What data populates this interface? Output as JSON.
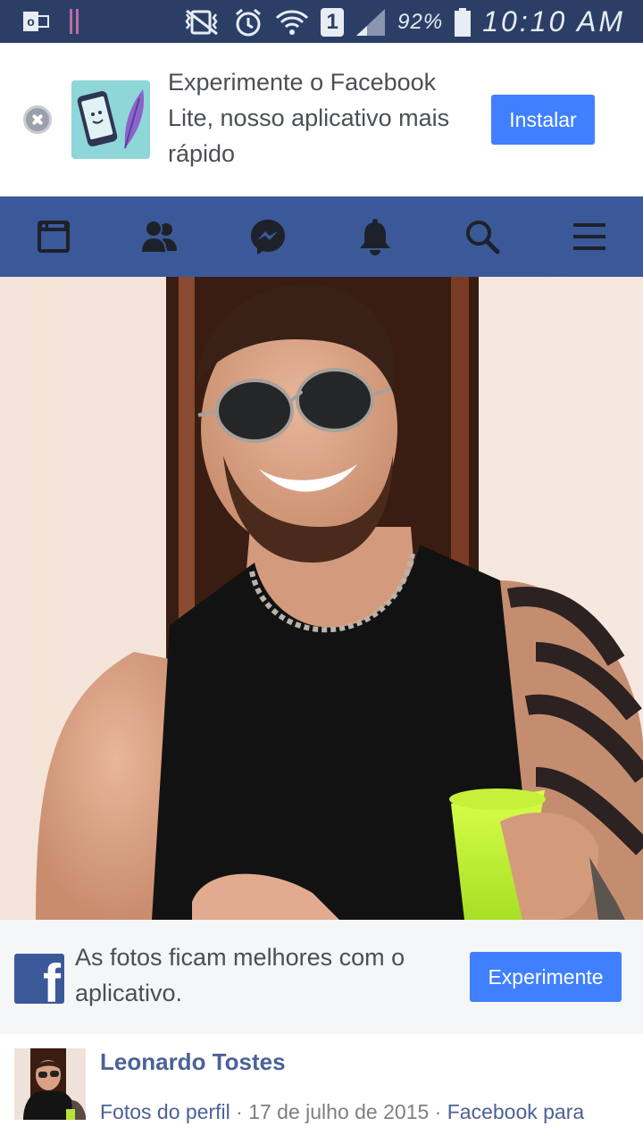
{
  "status_bar": {
    "battery": "92%",
    "clock": "10:10 AM",
    "sim": "1",
    "icons": [
      "outlook-icon",
      "pause-icon",
      "vibrate-icon",
      "alarm-icon",
      "wifi-icon",
      "sim-icon",
      "signal-icon",
      "battery-icon"
    ]
  },
  "install_banner": {
    "text": "Experimente o Facebook Lite, nosso aplicativo mais rápido",
    "button_label": "Instalar"
  },
  "nav": {
    "items": [
      "news-feed-icon",
      "friends-icon",
      "messenger-icon",
      "notifications-icon",
      "search-icon",
      "menu-icon"
    ]
  },
  "promo": {
    "text": "As fotos ficam melhores com o aplicativo.",
    "button_label": "Experimente",
    "logo_letter": "f"
  },
  "post": {
    "author": "Leonardo Tostes",
    "album": "Fotos do perfil",
    "separator": " · ",
    "date": "17 de julho de 2015",
    "source": "Facebook para"
  },
  "colors": {
    "status_bar": "#2b3f66",
    "facebook_blue": "#3b5998",
    "button_blue": "#4080ff"
  }
}
